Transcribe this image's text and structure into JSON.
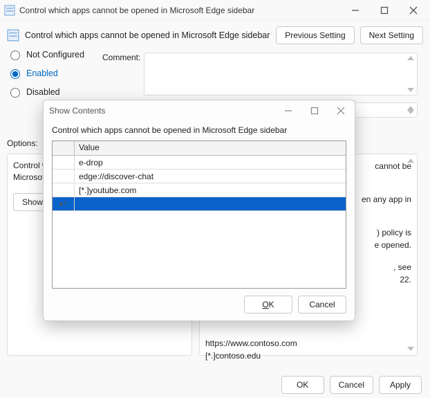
{
  "window": {
    "title": "Control which apps cannot be opened in Microsoft Edge sidebar",
    "header_title": "Control which apps cannot be opened in Microsoft Edge sidebar",
    "prev_btn": "Previous Setting",
    "next_btn": "Next Setting",
    "radios": {
      "not_configured": "Not Configured",
      "enabled": "Enabled",
      "disabled": "Disabled",
      "selected": "enabled"
    },
    "comment_label": "Comment:",
    "options_label": "Options:",
    "options_box_text": "Control which apps cannot be opened in Microsoft Edge sidebar",
    "show_btn": "Show...",
    "help_text_1": "cannot be",
    "help_text_2": "en any app in",
    "help_text_3": ") policy is",
    "help_text_4": "e opened.",
    "help_text_5": ", see",
    "help_text_6": "22.",
    "help_example_1": "https://www.contoso.com",
    "help_example_2": "[*.]contoso.edu",
    "footer": {
      "ok": "OK",
      "cancel": "Cancel",
      "apply": "Apply"
    }
  },
  "dialog": {
    "title": "Show Contents",
    "caption": "Control which apps cannot be opened in Microsoft Edge sidebar",
    "column_header": "Value",
    "rows": [
      "e-drop",
      "edge://discover-chat",
      "[*.]youtube.com"
    ],
    "new_row_marker": "▸*",
    "ok": "OK",
    "cancel": "Cancel"
  }
}
